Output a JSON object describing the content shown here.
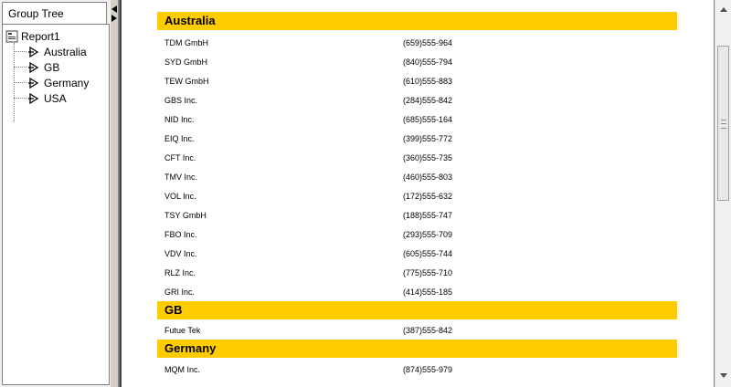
{
  "tree": {
    "tab_label": "Group Tree",
    "root_label": "Report1",
    "items": [
      {
        "label": "Australia"
      },
      {
        "label": "GB"
      },
      {
        "label": "Germany"
      },
      {
        "label": "USA"
      }
    ]
  },
  "report": {
    "groups": [
      {
        "name": "Australia",
        "rows": [
          {
            "company": "TDM GmbH",
            "phone": "(659)555-964"
          },
          {
            "company": "SYD GmbH",
            "phone": "(840)555-794"
          },
          {
            "company": "TEW GmbH",
            "phone": "(610)555-883"
          },
          {
            "company": "GBS Inc.",
            "phone": "(284)555-842"
          },
          {
            "company": "NID Inc.",
            "phone": "(685)555-164"
          },
          {
            "company": "EIQ Inc.",
            "phone": "(399)555-772"
          },
          {
            "company": "CFT Inc.",
            "phone": "(360)555-735"
          },
          {
            "company": "TMV Inc.",
            "phone": "(460)555-803"
          },
          {
            "company": "VOL Inc.",
            "phone": "(172)555-632"
          },
          {
            "company": "TSY GmbH",
            "phone": "(188)555-747"
          },
          {
            "company": "FBO Inc.",
            "phone": "(293)555-709"
          },
          {
            "company": "VDV Inc.",
            "phone": "(605)555-744"
          },
          {
            "company": "RLZ Inc.",
            "phone": "(775)555-710"
          },
          {
            "company": "GRI Inc.",
            "phone": "(414)555-185"
          }
        ]
      },
      {
        "name": "GB",
        "rows": [
          {
            "company": "Futue Tek",
            "phone": "(387)555-842"
          }
        ]
      },
      {
        "name": "Germany",
        "rows": [
          {
            "company": "MQM Inc.",
            "phone": "(874)555-979"
          }
        ]
      }
    ]
  },
  "colors": {
    "group_header": "#ffcc00"
  }
}
